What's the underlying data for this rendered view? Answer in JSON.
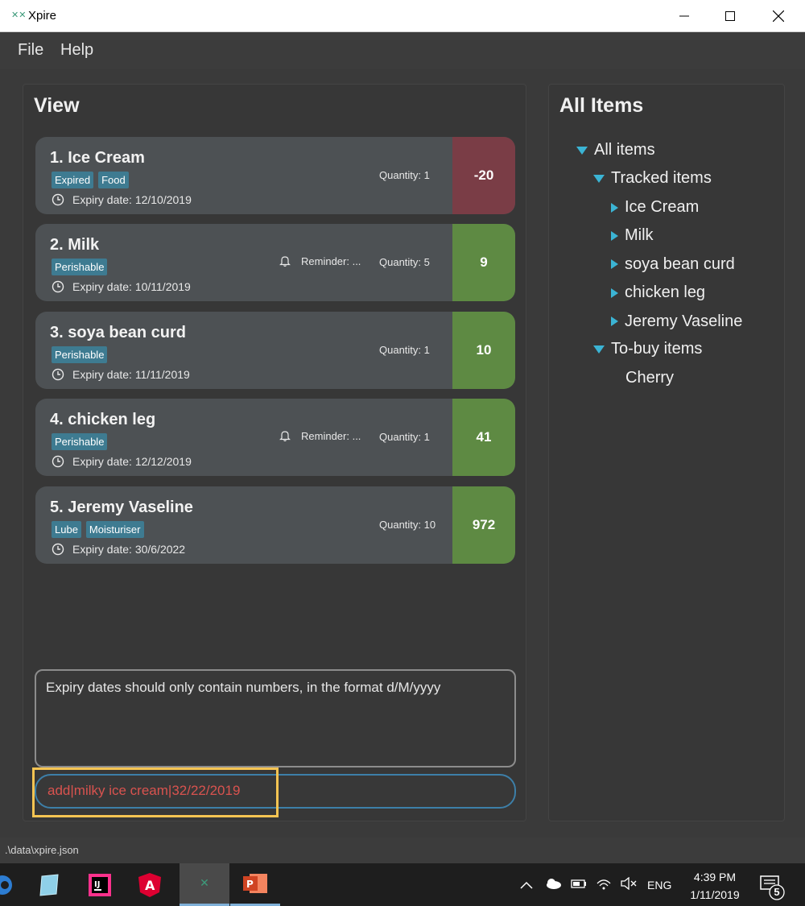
{
  "window": {
    "title": "Xpire",
    "app_icon_glyph": "X",
    "buttons": [
      "minimize",
      "maximize",
      "close"
    ]
  },
  "menu": {
    "items": [
      "File",
      "Help"
    ]
  },
  "view_panel": {
    "title": "View",
    "items": [
      {
        "name": "1.  Ice Cream",
        "tags": [
          "Expired",
          "Food"
        ],
        "expiry": "Expiry date: 12/10/2019",
        "quantity": "Quantity: 1",
        "reminder": null,
        "days": "-20",
        "status": "expired"
      },
      {
        "name": "2.  Milk",
        "tags": [
          "Perishable"
        ],
        "expiry": "Expiry date: 10/11/2019",
        "quantity": "Quantity: 5",
        "reminder": "Reminder: ...",
        "days": "9",
        "status": "ok"
      },
      {
        "name": "3.  soya bean curd",
        "tags": [
          "Perishable"
        ],
        "expiry": "Expiry date: 11/11/2019",
        "quantity": "Quantity: 1",
        "reminder": null,
        "days": "10",
        "status": "ok"
      },
      {
        "name": "4.  chicken leg",
        "tags": [
          "Perishable"
        ],
        "expiry": "Expiry date: 12/12/2019",
        "quantity": "Quantity: 1",
        "reminder": "Reminder: ...",
        "days": "41",
        "status": "ok"
      },
      {
        "name": "5.  Jeremy Vaseline",
        "tags": [
          "Lube",
          "Moisturiser"
        ],
        "expiry": "Expiry date: 30/6/2022",
        "quantity": "Quantity: 10",
        "reminder": null,
        "days": "972",
        "status": "ok"
      }
    ],
    "result_message": "Expiry dates should only contain numbers, in the format d/M/yyyy",
    "command_input": "add|milky ice cream|32/22/2019"
  },
  "all_items_panel": {
    "title": "All Items",
    "tree": {
      "root": "All items",
      "tracked_label": "Tracked items",
      "tracked": [
        "Ice Cream",
        "Milk",
        "soya bean curd",
        "chicken leg",
        "Jeremy Vaseline"
      ],
      "to_buy_label": "To-buy items",
      "to_buy": [
        "Cherry"
      ]
    }
  },
  "status_bar": {
    "path": ".\\data\\xpire.json"
  },
  "taskbar": {
    "apps": [
      "edge-icon",
      "notepad-icon",
      "intellij-icon",
      "angular-icon",
      "xpire-icon",
      "powerpoint-icon"
    ],
    "language": "ENG",
    "time": "4:39 PM",
    "date": "1/11/2019",
    "notification_count": "5"
  },
  "colors": {
    "accent_blue": "#3bb4d4",
    "expired_red": "#7a3d46",
    "ok_green": "#5e8a43",
    "tag_blue": "#3e7b91",
    "error_text": "#d9534f",
    "highlight_yellow": "#f5c452"
  }
}
